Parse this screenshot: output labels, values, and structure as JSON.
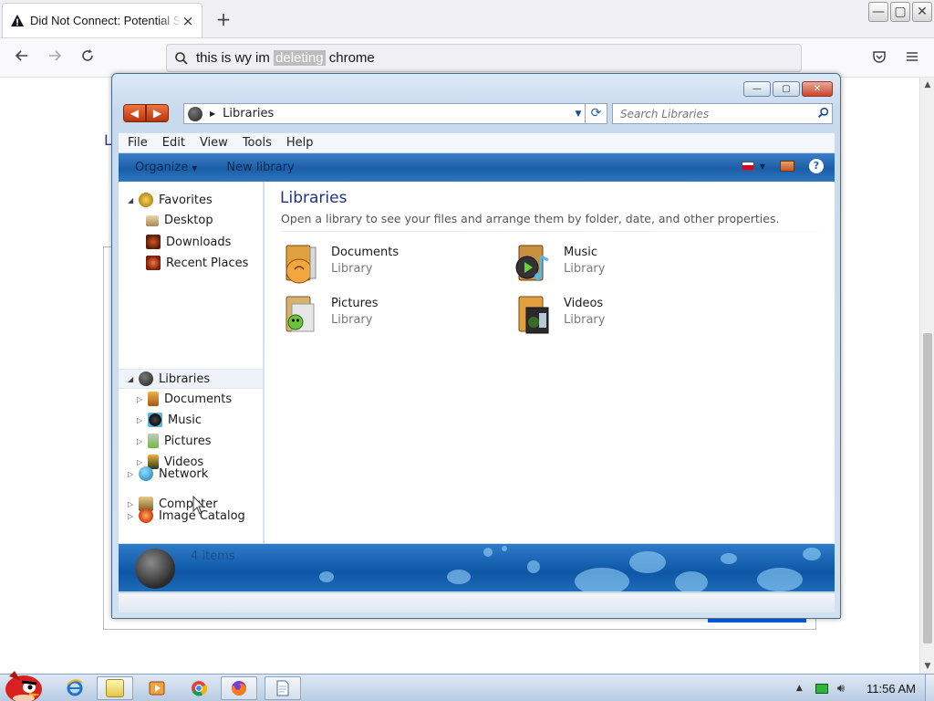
{
  "browser": {
    "tab_title": "Did Not Connect: Potential Security Issue",
    "tab_close": "×",
    "new_tab": "+",
    "url_query_before": "this is wy im ",
    "url_query_highlight": "deleting",
    "url_query_after": " chrome",
    "page_letter": "L"
  },
  "window_controls": {
    "minimize": "—",
    "maximize": "▢",
    "close": "✕"
  },
  "explorer": {
    "address_path": "Libraries",
    "search_placeholder": "Search Libraries",
    "menu": [
      "File",
      "Edit",
      "View",
      "Tools",
      "Help"
    ],
    "commands": {
      "organize": "Organize",
      "new_library": "New library"
    },
    "nav": {
      "favorites": "Favorites",
      "desktop": "Desktop",
      "downloads": "Downloads",
      "recent_places": "Recent Places",
      "libraries": "Libraries",
      "documents": "Documents",
      "music": "Music",
      "pictures": "Pictures",
      "videos": "Videos",
      "computer": "Computer",
      "network": "Network",
      "image_catalog": "Image Catalog"
    },
    "content": {
      "title": "Libraries",
      "subtitle": "Open a library to see your files and arrange them by folder, date, and other properties.",
      "tiles": [
        {
          "name": "Documents",
          "kind": "Library"
        },
        {
          "name": "Music",
          "kind": "Library"
        },
        {
          "name": "Pictures",
          "kind": "Library"
        },
        {
          "name": "Videos",
          "kind": "Library"
        }
      ]
    },
    "item_count": "4 items"
  },
  "taskbar": {
    "clock": "11:56 AM"
  },
  "colors": {
    "accent_blue": "#1b5ea8",
    "title_blue": "#1e3287",
    "nav_arrow_orange": "#e05a22"
  }
}
